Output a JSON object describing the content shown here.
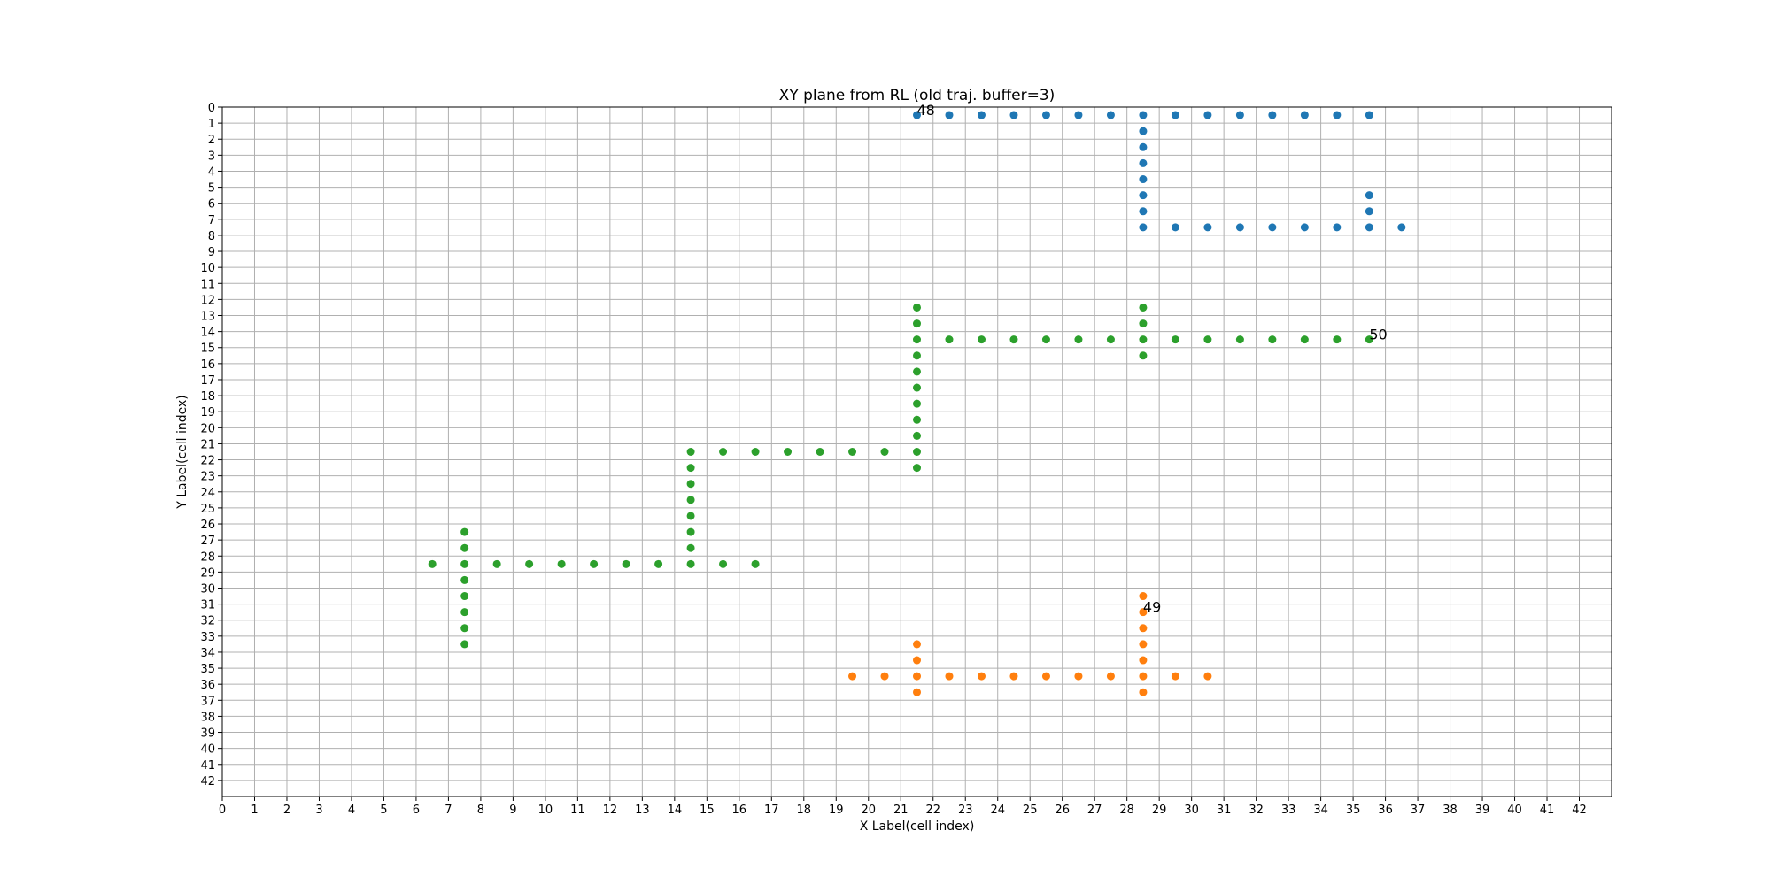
{
  "chart_data": {
    "type": "scatter",
    "title": "XY plane  from RL (old traj. buffer=3)",
    "xlabel": "X Label(cell index)",
    "ylabel": "Y Label(cell index)",
    "xlim": [
      0,
      43
    ],
    "ylim": [
      43,
      0
    ],
    "y_inverted": true,
    "grid": true,
    "xticks": [
      0,
      1,
      2,
      3,
      4,
      5,
      6,
      7,
      8,
      9,
      10,
      11,
      12,
      13,
      14,
      15,
      16,
      17,
      18,
      19,
      20,
      21,
      22,
      23,
      24,
      25,
      26,
      27,
      28,
      29,
      30,
      31,
      32,
      33,
      34,
      35,
      36,
      37,
      38,
      39,
      40,
      41,
      42
    ],
    "yticks": [
      0,
      1,
      2,
      3,
      4,
      5,
      6,
      7,
      8,
      9,
      10,
      11,
      12,
      13,
      14,
      15,
      16,
      17,
      18,
      19,
      20,
      21,
      22,
      23,
      24,
      25,
      26,
      27,
      28,
      29,
      30,
      31,
      32,
      33,
      34,
      35,
      36,
      37,
      38,
      39,
      40,
      41,
      42
    ],
    "series": [
      {
        "color": "#1f77b4",
        "points": [
          [
            21.5,
            0.5
          ],
          [
            22.5,
            0.5
          ],
          [
            23.5,
            0.5
          ],
          [
            24.5,
            0.5
          ],
          [
            25.5,
            0.5
          ],
          [
            26.5,
            0.5
          ],
          [
            27.5,
            0.5
          ],
          [
            28.5,
            0.5
          ],
          [
            29.5,
            0.5
          ],
          [
            30.5,
            0.5
          ],
          [
            31.5,
            0.5
          ],
          [
            32.5,
            0.5
          ],
          [
            33.5,
            0.5
          ],
          [
            34.5,
            0.5
          ],
          [
            35.5,
            0.5
          ],
          [
            28.5,
            1.5
          ],
          [
            28.5,
            2.5
          ],
          [
            28.5,
            3.5
          ],
          [
            28.5,
            4.5
          ],
          [
            28.5,
            5.5
          ],
          [
            28.5,
            6.5
          ],
          [
            28.5,
            7.5
          ],
          [
            35.5,
            5.5
          ],
          [
            35.5,
            6.5
          ],
          [
            29.5,
            7.5
          ],
          [
            30.5,
            7.5
          ],
          [
            31.5,
            7.5
          ],
          [
            32.5,
            7.5
          ],
          [
            33.5,
            7.5
          ],
          [
            34.5,
            7.5
          ],
          [
            35.5,
            7.5
          ],
          [
            36.5,
            7.5
          ]
        ]
      },
      {
        "color": "#ff7f0e",
        "points": [
          [
            28.5,
            30.5
          ],
          [
            28.5,
            31.5
          ],
          [
            28.5,
            32.5
          ],
          [
            28.5,
            33.5
          ],
          [
            28.5,
            34.5
          ],
          [
            28.5,
            35.5
          ],
          [
            28.5,
            36.5
          ],
          [
            21.5,
            33.5
          ],
          [
            21.5,
            34.5
          ],
          [
            21.5,
            35.5
          ],
          [
            21.5,
            36.5
          ],
          [
            19.5,
            35.5
          ],
          [
            20.5,
            35.5
          ],
          [
            22.5,
            35.5
          ],
          [
            23.5,
            35.5
          ],
          [
            24.5,
            35.5
          ],
          [
            25.5,
            35.5
          ],
          [
            26.5,
            35.5
          ],
          [
            27.5,
            35.5
          ],
          [
            29.5,
            35.5
          ],
          [
            30.5,
            35.5
          ]
        ]
      },
      {
        "color": "#2ca02c",
        "points": [
          [
            21.5,
            12.5
          ],
          [
            21.5,
            13.5
          ],
          [
            21.5,
            14.5
          ],
          [
            21.5,
            15.5
          ],
          [
            21.5,
            16.5
          ],
          [
            21.5,
            17.5
          ],
          [
            21.5,
            18.5
          ],
          [
            21.5,
            19.5
          ],
          [
            21.5,
            20.5
          ],
          [
            21.5,
            21.5
          ],
          [
            21.5,
            22.5
          ],
          [
            22.5,
            14.5
          ],
          [
            23.5,
            14.5
          ],
          [
            24.5,
            14.5
          ],
          [
            25.5,
            14.5
          ],
          [
            26.5,
            14.5
          ],
          [
            27.5,
            14.5
          ],
          [
            28.5,
            14.5
          ],
          [
            29.5,
            14.5
          ],
          [
            30.5,
            14.5
          ],
          [
            31.5,
            14.5
          ],
          [
            32.5,
            14.5
          ],
          [
            33.5,
            14.5
          ],
          [
            34.5,
            14.5
          ],
          [
            35.5,
            14.5
          ],
          [
            28.5,
            12.5
          ],
          [
            28.5,
            13.5
          ],
          [
            28.5,
            15.5
          ],
          [
            14.5,
            21.5
          ],
          [
            15.5,
            21.5
          ],
          [
            16.5,
            21.5
          ],
          [
            17.5,
            21.5
          ],
          [
            18.5,
            21.5
          ],
          [
            19.5,
            21.5
          ],
          [
            20.5,
            21.5
          ],
          [
            14.5,
            22.5
          ],
          [
            14.5,
            23.5
          ],
          [
            14.5,
            24.5
          ],
          [
            14.5,
            25.5
          ],
          [
            14.5,
            26.5
          ],
          [
            14.5,
            27.5
          ],
          [
            14.5,
            28.5
          ],
          [
            6.5,
            28.5
          ],
          [
            7.5,
            28.5
          ],
          [
            8.5,
            28.5
          ],
          [
            9.5,
            28.5
          ],
          [
            10.5,
            28.5
          ],
          [
            11.5,
            28.5
          ],
          [
            12.5,
            28.5
          ],
          [
            13.5,
            28.5
          ],
          [
            15.5,
            28.5
          ],
          [
            16.5,
            28.5
          ],
          [
            7.5,
            26.5
          ],
          [
            7.5,
            27.5
          ],
          [
            7.5,
            29.5
          ],
          [
            7.5,
            30.5
          ],
          [
            7.5,
            31.5
          ],
          [
            7.5,
            32.5
          ],
          [
            7.5,
            33.5
          ]
        ]
      }
    ],
    "annotations": [
      {
        "text": "48",
        "x": 21.5,
        "y": 0.5
      },
      {
        "text": "50",
        "x": 35.5,
        "y": 14.5
      },
      {
        "text": "49",
        "x": 28.5,
        "y": 31.5
      }
    ]
  }
}
